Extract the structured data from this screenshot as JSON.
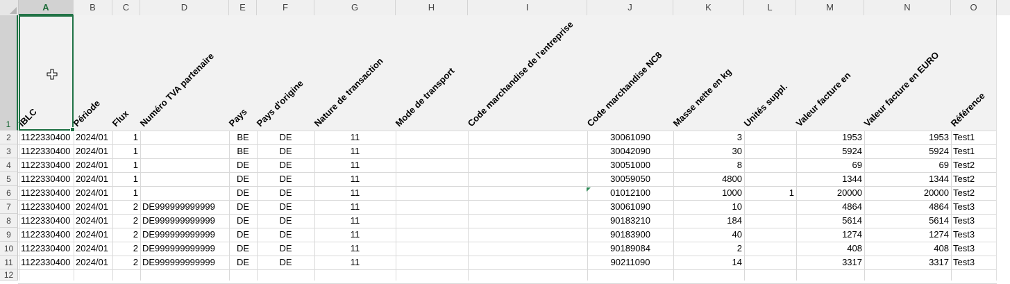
{
  "columns": [
    "A",
    "B",
    "C",
    "D",
    "E",
    "F",
    "G",
    "H",
    "I",
    "J",
    "K",
    "L",
    "M",
    "N",
    "O"
  ],
  "header_row_number": "1",
  "headers": [
    "IBLC",
    "Période",
    "Flux",
    "Numéro TVA partenaire",
    "Pays",
    "Pays d'origine",
    "Nature de transaction",
    "Mode de transport",
    "Code marchandise de l'entreprise",
    "Code marchandise NC8",
    "Masse nette en kg",
    "Unités suppl.",
    "Valeur facture en",
    "Valeur facture en EURO",
    "Référence"
  ],
  "rows": [
    {
      "n": "2",
      "cells": [
        "1122330400",
        "2024/01",
        "1",
        "",
        "BE",
        "DE",
        "11",
        "",
        "",
        "30061090",
        "3",
        "",
        "1953",
        "1953",
        "Test1"
      ]
    },
    {
      "n": "3",
      "cells": [
        "1122330400",
        "2024/01",
        "1",
        "",
        "BE",
        "DE",
        "11",
        "",
        "",
        "30042090",
        "30",
        "",
        "5924",
        "5924",
        "Test1"
      ]
    },
    {
      "n": "4",
      "cells": [
        "1122330400",
        "2024/01",
        "1",
        "",
        "DE",
        "DE",
        "11",
        "",
        "",
        "30051000",
        "8",
        "",
        "69",
        "69",
        "Test2"
      ]
    },
    {
      "n": "5",
      "cells": [
        "1122330400",
        "2024/01",
        "1",
        "",
        "DE",
        "DE",
        "11",
        "",
        "",
        "30059050",
        "4800",
        "",
        "1344",
        "1344",
        "Test2"
      ]
    },
    {
      "n": "6",
      "cells": [
        "1122330400",
        "2024/01",
        "1",
        "",
        "DE",
        "DE",
        "11",
        "",
        "",
        "01012100",
        "1000",
        "1",
        "20000",
        "20000",
        "Test2"
      ]
    },
    {
      "n": "7",
      "cells": [
        "1122330400",
        "2024/01",
        "2",
        "DE999999999999",
        "DE",
        "DE",
        "11",
        "",
        "",
        "30061090",
        "10",
        "",
        "4864",
        "4864",
        "Test3"
      ]
    },
    {
      "n": "8",
      "cells": [
        "1122330400",
        "2024/01",
        "2",
        "DE999999999999",
        "DE",
        "DE",
        "11",
        "",
        "",
        "90183210",
        "184",
        "",
        "5614",
        "5614",
        "Test3"
      ]
    },
    {
      "n": "9",
      "cells": [
        "1122330400",
        "2024/01",
        "2",
        "DE999999999999",
        "DE",
        "DE",
        "11",
        "",
        "",
        "90183900",
        "40",
        "",
        "1274",
        "1274",
        "Test3"
      ]
    },
    {
      "n": "10",
      "cells": [
        "1122330400",
        "2024/01",
        "2",
        "DE999999999999",
        "DE",
        "DE",
        "11",
        "",
        "",
        "90189084",
        "2",
        "",
        "408",
        "408",
        "Test3"
      ]
    },
    {
      "n": "11",
      "cells": [
        "1122330400",
        "2024/01",
        "2",
        "DE999999999999",
        "DE",
        "DE",
        "11",
        "",
        "",
        "90211090",
        "14",
        "",
        "3317",
        "3317",
        "Test3"
      ]
    }
  ],
  "empty_row_number": "12",
  "selection": {
    "cell": "A1",
    "accent_color": "#217346"
  },
  "icons": {
    "pointer": "excel-cross-cursor-icon",
    "text_number_marker": "green-triangle-icon"
  }
}
